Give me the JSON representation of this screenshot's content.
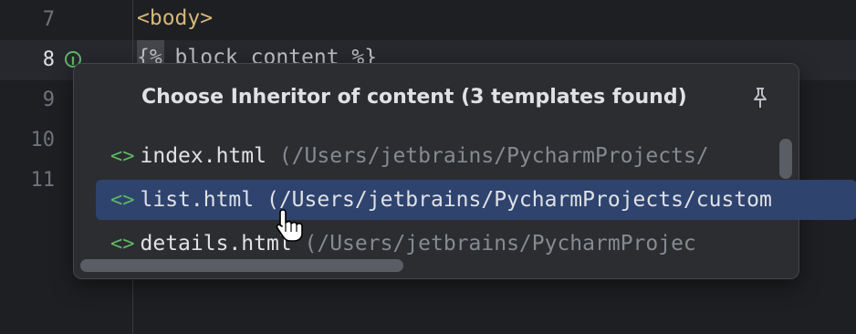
{
  "editor": {
    "lines": [
      {
        "number": "7",
        "code": "<body>"
      },
      {
        "number": "8",
        "code": "{% block content %}"
      },
      {
        "number": "9",
        "code": ""
      },
      {
        "number": "10",
        "code": ""
      },
      {
        "number": "11",
        "code": ""
      }
    ],
    "gutter_marker_icon": "implemented-marker-icon"
  },
  "popup": {
    "title": "Choose Inheritor of content (3 templates found)",
    "pin_icon": "pin-icon",
    "items": [
      {
        "icon": "<>",
        "name": "index.html",
        "path": " (/Users/jetbrains/PycharmProjects/"
      },
      {
        "icon": "<>",
        "name": "list.html",
        "path": " (/Users/jetbrains/PycharmProjects/custom"
      },
      {
        "icon": "<>",
        "name": "details.html",
        "path": " (/Users/jetbrains/PycharmProjec"
      }
    ]
  },
  "colors": {
    "background": "#1e1f22",
    "popup_bg": "#2b2d30",
    "selection": "#2e436e",
    "accent_green": "#5fb865",
    "tag_yellow": "#d5b778"
  }
}
